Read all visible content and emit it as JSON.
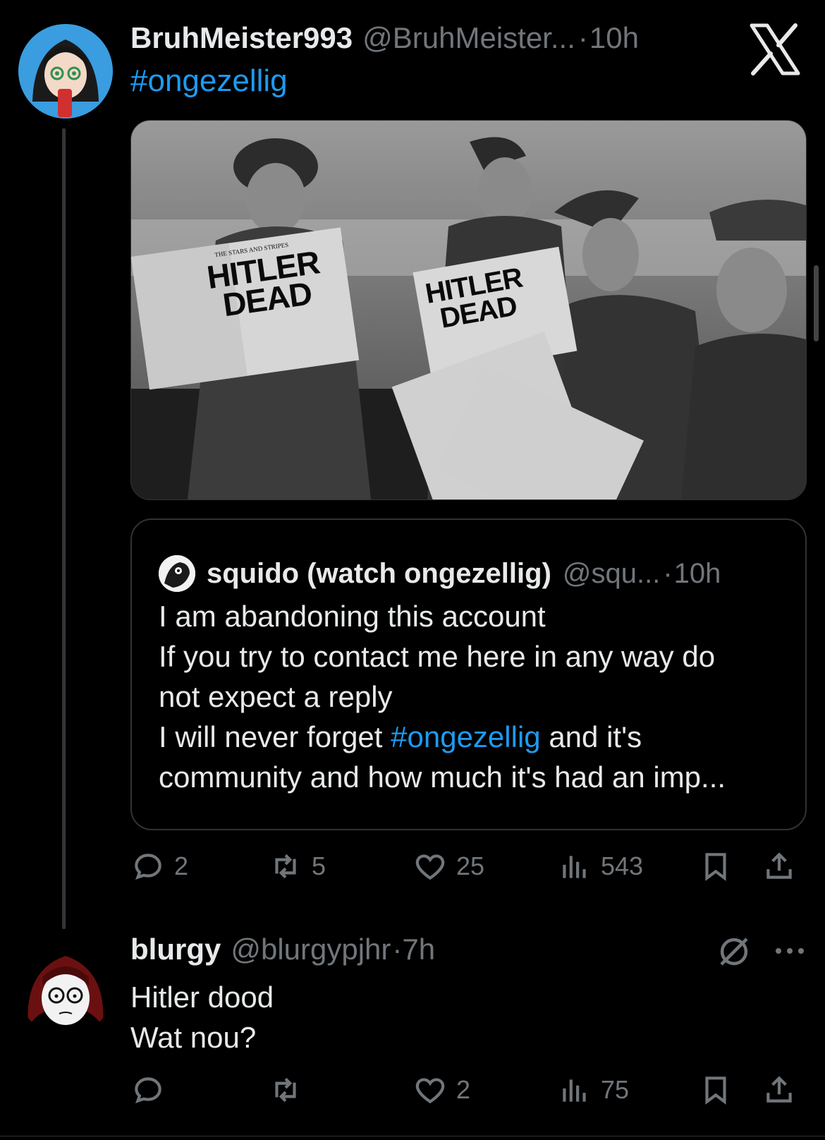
{
  "tweet": {
    "display_name": "BruhMeister993",
    "handle": "@BruhMeister...",
    "separator": "·",
    "time": "10h",
    "hashtag": "#ongezellig",
    "photo_headline_line1": "HITLER",
    "photo_headline_line2": "DEAD",
    "photo_masthead": "THE STARS AND STRIPES",
    "quote": {
      "display_name": "squido (watch ongezellig)",
      "handle": "@squ...",
      "separator": "·",
      "time": "10h",
      "line1": "I am abandoning this account",
      "line2": "If you try to contact me here in any way do",
      "line3": "not expect a reply",
      "line4_before": "I will never forget ",
      "line4_hashtag": "#ongezellig",
      "line4_after": " and it's",
      "line5": "community and how much it's had an imp..."
    },
    "stats": {
      "replies": "2",
      "reposts": "5",
      "likes": "25",
      "views": "543"
    }
  },
  "reply": {
    "display_name": "blurgy",
    "handle": "@blurgypjhr",
    "separator": "·",
    "time": "7h",
    "line1": "Hitler dood",
    "line2": "Wat nou?",
    "stats": {
      "replies": "",
      "reposts": "",
      "likes": "2",
      "views": "75"
    }
  },
  "colors": {
    "background": "#000000",
    "text": "#e7e9ea",
    "muted": "#71767b",
    "link": "#1d9bf0",
    "border": "#2f3336"
  },
  "icons": {
    "x_logo": "x-logo-icon",
    "reply": "speech-bubble-icon",
    "repost": "repost-arrows-icon",
    "like": "heart-icon",
    "views": "bar-chart-icon",
    "bookmark": "bookmark-icon",
    "share": "share-upload-icon",
    "muted": "no-symbol-icon",
    "more": "ellipsis-icon"
  }
}
